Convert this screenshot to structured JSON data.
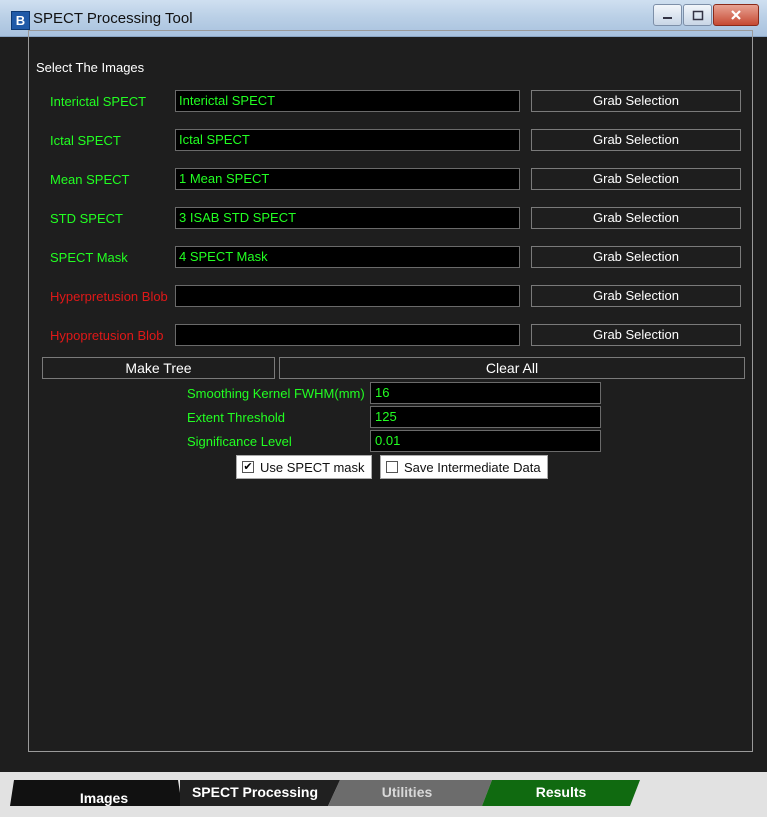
{
  "window": {
    "title": "SPECT Processing Tool",
    "app_icon_letter": "B"
  },
  "group": {
    "title": "Select The Images"
  },
  "rows": [
    {
      "label": "Interictal SPECT",
      "value": "Interictal SPECT",
      "button": "Grab Selection",
      "color": "#22ff22"
    },
    {
      "label": "Ictal SPECT",
      "value": "Ictal SPECT",
      "button": "Grab Selection",
      "color": "#22ff22"
    },
    {
      "label": "Mean SPECT",
      "value": "1 Mean SPECT",
      "button": "Grab Selection",
      "color": "#22ff22"
    },
    {
      "label": "STD SPECT",
      "value": "3 ISAB STD SPECT",
      "button": "Grab Selection",
      "color": "#22ff22"
    },
    {
      "label": "SPECT Mask",
      "value": "4 SPECT Mask",
      "button": "Grab Selection",
      "color": "#22ff22"
    },
    {
      "label": "Hyperpretusion Blob",
      "value": "",
      "button": "Grab Selection",
      "color": "#e01818"
    },
    {
      "label": "Hypopretusion Blob",
      "value": "",
      "button": "Grab Selection",
      "color": "#e01818"
    }
  ],
  "actions": {
    "make_tree": "Make Tree",
    "clear_all": "Clear All"
  },
  "params": [
    {
      "label": "Smoothing Kernel FWHM(mm)",
      "value": "16"
    },
    {
      "label": "Extent Threshold",
      "value": "125"
    },
    {
      "label": "Significance Level",
      "value": "0.01"
    }
  ],
  "options": {
    "use_mask": {
      "label": "Use SPECT mask",
      "checked": true
    },
    "save_data": {
      "label": "Save Intermediate Data",
      "checked": false
    }
  },
  "tabs": [
    {
      "label": "Images",
      "color": "#111111"
    },
    {
      "label": "SPECT Processing",
      "color": "#111111"
    },
    {
      "label": "Utilities",
      "color": "#6c6c6c"
    },
    {
      "label": "Results",
      "color": "#106a10"
    }
  ]
}
